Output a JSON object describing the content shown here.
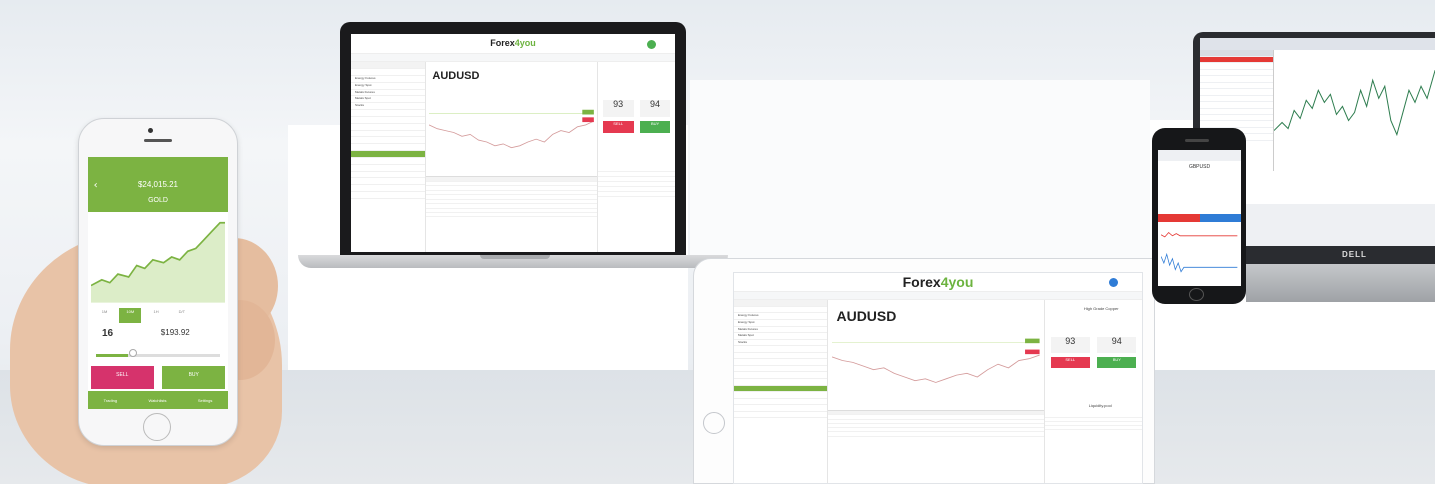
{
  "colors": {
    "brand_green": "#7cb342",
    "sell_red": "#e53950",
    "buy_green": "#4caf50",
    "mt_buy_blue": "#2f7cd6"
  },
  "mobile_app": {
    "balance": "$24,015.21",
    "symbol": "GOLD",
    "tabs": [
      "1M",
      "10M",
      "1H",
      "D/T"
    ],
    "active_tab": "10M",
    "amount": "16",
    "amount_caption": "AMOUNT",
    "price": "$193.92",
    "price_caption": "REQUIRED",
    "sell_label": "SELL",
    "sell_price": "1211.5",
    "buy_label": "BUY",
    "buy_price": "1211.9",
    "nav": [
      "Trading",
      "Watchlists",
      "Settings"
    ]
  },
  "web_terminal": {
    "brand_prefix": "Forex",
    "brand_suffix": "4you",
    "symbol": "AUDUSD",
    "bid_big": "93",
    "ask_big": "94",
    "sell_label": "SELL",
    "buy_label": "BUY",
    "right_panel_title": "High Grade Copper",
    "tabs": [
      "Summary",
      "Open orders",
      "Pending orders",
      "History",
      "Trades"
    ],
    "left_groups": [
      "Energy Futures",
      "Energy Spot",
      "Metals Futures",
      "Metals Spot",
      "Stocks"
    ],
    "liquidity_label": "Liquidity.pool"
  },
  "metatrader": {
    "brand": "DELL",
    "symbol": "GBPUSD"
  }
}
